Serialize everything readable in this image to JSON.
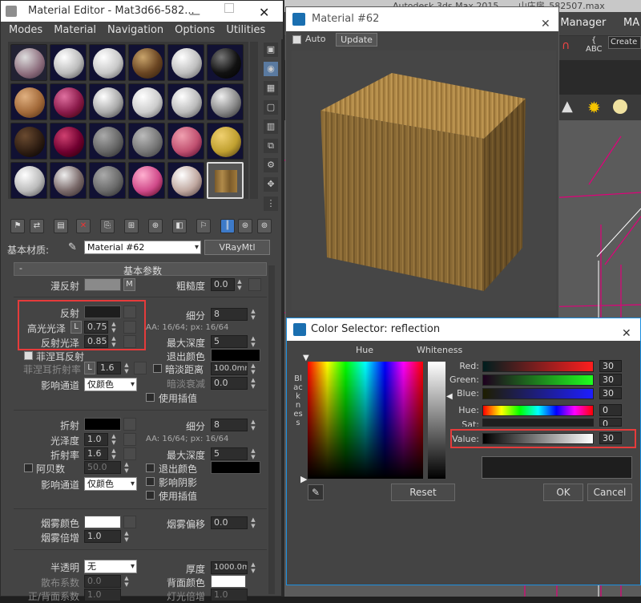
{
  "max_window": {
    "title": "Autodesk 3ds Max 2015",
    "file_title": "山庄房_582507.max",
    "scene_explorer_fragment": "ect Manager",
    "ma_fragment": "MA",
    "create_fragment": "Create S"
  },
  "material_editor": {
    "title": "Material Editor - Mat3d66-582...",
    "menu": [
      "Modes",
      "Material",
      "Navigation",
      "Options",
      "Utilities"
    ],
    "base_material_label": "基本材质:",
    "material_name": "Material #62",
    "material_type": "VRayMtl",
    "rollout_title": "基本参数",
    "rollout_minus": "-",
    "diffuse_label": "漫反射",
    "diffuse_map": "M",
    "roughness_label": "粗糙度",
    "roughness_value": "0.0",
    "reflect_label": "反射",
    "hilight_label": "高光光泽",
    "hilight_lock": "L",
    "hilight_value": "0.75",
    "refl_gloss_label": "反射光泽",
    "refl_gloss_value": "0.85",
    "subdivs_label": "细分",
    "subdivs_value": "8",
    "aa_text": "AA: 16/64; px: 16/64",
    "max_depth_label": "最大深度",
    "max_depth_value": "5",
    "fresnel_label": "菲涅耳反射",
    "exit_color_label": "退出颜色",
    "fresnel_ior_label": "菲涅耳折射率",
    "fresnel_lock": "L",
    "fresnel_ior_value": "1.6",
    "dim_distance_label": "暗淡距离",
    "dim_distance_value": "100.0mm",
    "dim_falloff_label": "暗淡衰减",
    "dim_falloff_value": "0.0",
    "affect_channels_label": "影响通道",
    "affect_channels_value": "仅颜色",
    "use_interp_label": "使用插值",
    "refract_label": "折射",
    "refr_subdivs_label": "细分",
    "refr_subdivs_value": "8",
    "gloss_label": "光泽度",
    "gloss_value": "1.0",
    "refr_aa_text": "AA: 16/64; px: 16/64",
    "ior_label": "折射率",
    "ior_value": "1.6",
    "refr_max_depth_label": "最大深度",
    "refr_max_depth_value": "5",
    "abbe_label": "阿贝数",
    "abbe_value": "50.0",
    "refr_exit_color_label": "退出颜色",
    "affect_shadows_label": "影响阴影",
    "refr_affect_channels_label": "影响通道",
    "refr_affect_channels_value": "仅颜色",
    "refr_use_interp_label": "使用插值",
    "fog_color_label": "烟雾颜色",
    "fog_bias_label": "烟雾偏移",
    "fog_bias_value": "0.0",
    "fog_mult_label": "烟雾倍增",
    "fog_mult_value": "1.0",
    "translucency_label": "半透明",
    "translucency_value": "无",
    "thickness_label": "厚度",
    "thickness_value": "1000.0mm",
    "scatter_label": "散布系数",
    "scatter_value": "0.0",
    "back_color_label": "背面颜色",
    "fwd_back_label": "正/背面系数",
    "fwd_back_value": "1.0",
    "light_mult_label": "灯光倍增",
    "light_mult_value": "1.0"
  },
  "preview_window": {
    "title": "Material #62",
    "auto_label": "Auto",
    "update_label": "Update"
  },
  "color_selector": {
    "title": "Color Selector: reflection",
    "hue_header": "Hue",
    "whiteness_header": "Whiteness",
    "blackness_label": "Blackness",
    "channels": [
      {
        "label": "Red:",
        "value": "30"
      },
      {
        "label": "Green:",
        "value": "30"
      },
      {
        "label": "Blue:",
        "value": "30"
      },
      {
        "label": "Hue:",
        "value": "0"
      },
      {
        "label": "Sat:",
        "value": "0"
      },
      {
        "label": "Value:",
        "value": "30"
      }
    ],
    "reset_label": "Reset",
    "ok_label": "OK",
    "cancel_label": "Cancel"
  },
  "colors": {
    "highlight_box": "#e53b3b",
    "reflect_swatch": "#1e1e1e",
    "refract_swatch": "#000000",
    "fog_swatch": "#ffffff",
    "title_accent": "#1c8fe0"
  }
}
